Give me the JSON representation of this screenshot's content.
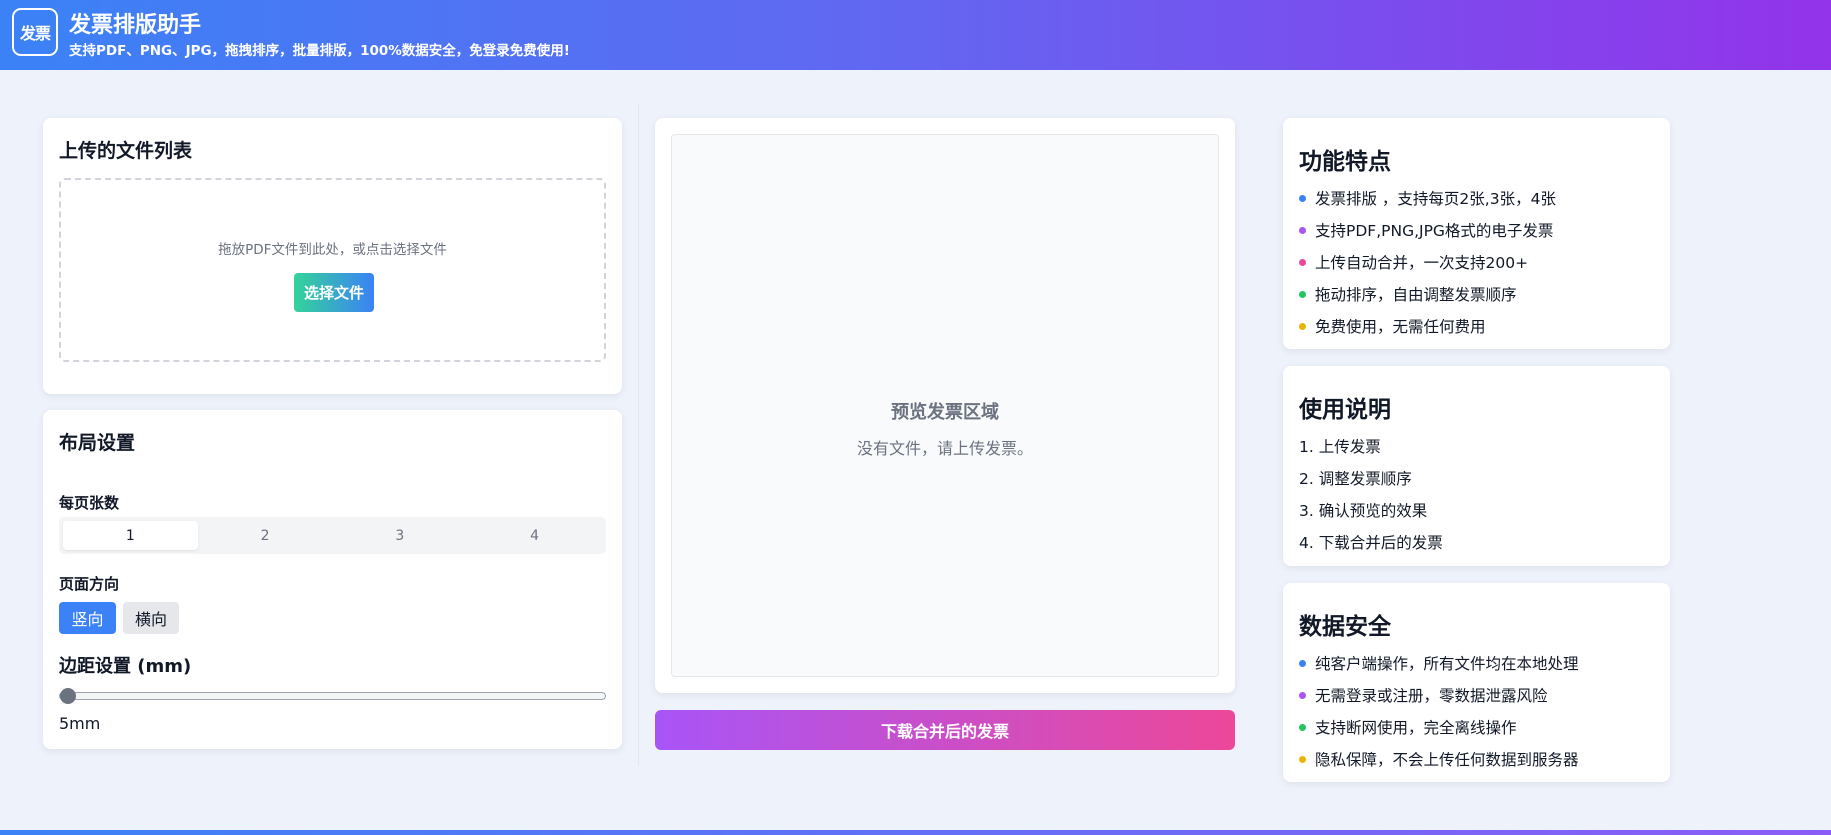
{
  "header": {
    "logo_text": "发票",
    "title": "发票排版助手",
    "subtitle": "支持PDF、PNG、JPG，拖拽排序，批量排版，100%数据安全，免登录免费使用!"
  },
  "upload": {
    "title": "上传的文件列表",
    "drop_hint": "拖放PDF文件到此处，或点击选择文件",
    "select_button": "选择文件"
  },
  "layout": {
    "title": "布局设置",
    "per_page_label": "每页张数",
    "per_page_options": [
      "1",
      "2",
      "3",
      "4"
    ],
    "per_page_selected": "1",
    "orientation_label": "页面方向",
    "orientation_options": [
      "竖向",
      "横向"
    ],
    "orientation_selected": "竖向",
    "margin_label": "边距设置 (mm)",
    "margin_value": "5mm",
    "margin_slider_fraction": 0
  },
  "preview": {
    "title": "预览发票区域",
    "empty_text": "没有文件，请上传发票。",
    "download_button": "下载合并后的发票"
  },
  "features": {
    "title": "功能特点",
    "items": [
      {
        "text": "发票排版 ，支持每页2张,3张，4张",
        "color": "#3b82f6"
      },
      {
        "text": "支持PDF,PNG,JPG格式的电子发票",
        "color": "#a855f7"
      },
      {
        "text": "上传自动合并，一次支持200+",
        "color": "#ec4899"
      },
      {
        "text": "拖动排序，自由调整发票顺序",
        "color": "#22c55e"
      },
      {
        "text": "免费使用，无需任何费用",
        "color": "#eab308"
      }
    ]
  },
  "usage": {
    "title": "使用说明",
    "items": [
      "1. 上传发票",
      "2. 调整发票顺序",
      "3. 确认预览的效果",
      "4. 下载合并后的发票"
    ]
  },
  "security": {
    "title": "数据安全",
    "items": [
      {
        "text": "纯客户端操作，所有文件均在本地处理",
        "color": "#3b82f6"
      },
      {
        "text": "无需登录或注册，零数据泄露风险",
        "color": "#a855f7"
      },
      {
        "text": "支持断网使用，完全离线操作",
        "color": "#22c55e"
      },
      {
        "text": "隐私保障，不会上传任何数据到服务器",
        "color": "#eab308"
      }
    ]
  }
}
